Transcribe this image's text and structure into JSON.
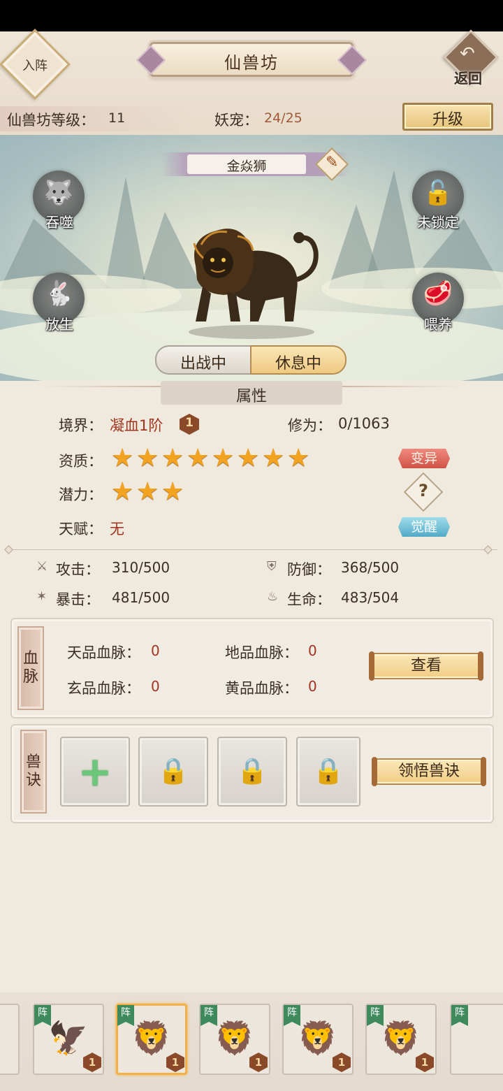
{
  "header": {
    "enter_label": "入阵",
    "title": "仙兽坊",
    "back_label": "返回",
    "level_label": "仙兽坊等级：",
    "level_value": "11",
    "pet_label": "妖宠：",
    "pet_value": "24/25",
    "upgrade_label": "升级"
  },
  "scene": {
    "pet_name": "金焱狮",
    "left_actions": [
      {
        "label": "吞噬",
        "icon": "wolf-icon"
      },
      {
        "label": "放生",
        "icon": "rabbit-icon"
      }
    ],
    "right_actions": [
      {
        "label": "未锁定",
        "icon": "unlock-icon"
      },
      {
        "label": "喂养",
        "icon": "meat-icon"
      }
    ],
    "status_tabs": [
      "出战中",
      "休息中"
    ],
    "active_tab": "休息中"
  },
  "attributes": {
    "section_title": "属性",
    "realm_label": "境界：",
    "realm_value": "凝血1阶",
    "realm_rank": "1",
    "cultivation_label": "修为：",
    "cultivation_value": "0/1063",
    "aptitude_label": "资质：",
    "aptitude_stars": 8,
    "potential_label": "潜力：",
    "potential_stars": 3,
    "talent_label": "天赋：",
    "talent_value": "无",
    "mutate_label": "变异",
    "help_label": "?",
    "awaken_label": "觉醒"
  },
  "stats": {
    "attack_label": "攻击：",
    "attack_value": "310/500",
    "defense_label": "防御：",
    "defense_value": "368/500",
    "crit_label": "暴击：",
    "crit_value": "481/500",
    "hp_label": "生命：",
    "hp_value": "483/504"
  },
  "bloodline": {
    "tab_label": "血脉",
    "heaven_label": "天品血脉：",
    "heaven_value": "0",
    "earth_label": "地品血脉：",
    "earth_value": "0",
    "mystic_label": "玄品血脉：",
    "mystic_value": "0",
    "yellow_label": "黄品血脉：",
    "yellow_value": "0",
    "view_label": "查看"
  },
  "skills": {
    "tab_label": "兽诀",
    "slot_add": "+",
    "learn_label": "领悟兽诀"
  },
  "pet_bar": {
    "flag_label": "阵",
    "pets": [
      {
        "icon": "phoenix-icon",
        "rank": "1",
        "selected": false
      },
      {
        "icon": "golden-lion-icon",
        "rank": "1",
        "selected": true
      },
      {
        "icon": "blue-lion-icon",
        "rank": "1",
        "selected": false
      },
      {
        "icon": "teal-lion-icon",
        "rank": "1",
        "selected": false
      },
      {
        "icon": "blue-lion-icon",
        "rank": "1",
        "selected": false
      }
    ]
  },
  "colors": {
    "accent_red": "#a0341e",
    "star": "#f2a321",
    "tab_active": "#eec983",
    "mutate": "#cf5346",
    "awaken": "#52aac6"
  }
}
